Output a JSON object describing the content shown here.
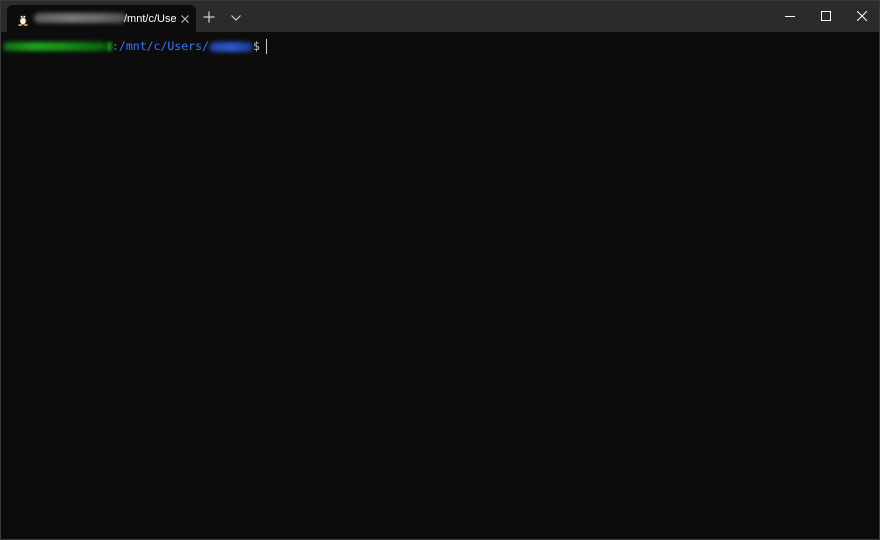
{
  "window": {
    "tab": {
      "title": "/mnt/c/Use",
      "icon": "linux-penguin-icon",
      "close_icon": "close-icon"
    },
    "new_tab_icon": "plus-icon",
    "dropdown_icon": "chevron-down-icon",
    "controls": {
      "minimize_icon": "minimize-icon",
      "maximize_icon": "maximize-icon",
      "close_icon": "close-icon"
    }
  },
  "terminal": {
    "prompt": {
      "path": ":/mnt/c/Users/",
      "symbol": "$"
    },
    "colors": {
      "background": "#0c0c0c",
      "user_host": "#16c60c",
      "path": "#3b78ff",
      "text": "#cccccc"
    }
  }
}
